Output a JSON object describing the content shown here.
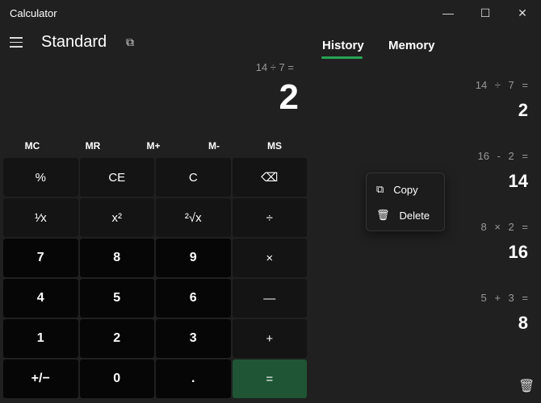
{
  "window": {
    "title": "Calculator",
    "minimize": "—",
    "maximize": "☐",
    "close": "✕"
  },
  "header": {
    "mode": "Standard",
    "keep_on_top": "⧉"
  },
  "display": {
    "expression": "14 ÷ 7 =",
    "result": "2"
  },
  "memory": [
    "MC",
    "MR",
    "M+",
    "M-",
    "MS"
  ],
  "keys": [
    {
      "l": "%",
      "t": "f"
    },
    {
      "l": "CE",
      "t": "f"
    },
    {
      "l": "C",
      "t": "f"
    },
    {
      "l": "⌫",
      "t": "f"
    },
    {
      "l": "¹⁄x",
      "t": "f"
    },
    {
      "l": "x²",
      "t": "f"
    },
    {
      "l": "²√x",
      "t": "f"
    },
    {
      "l": "÷",
      "t": "f"
    },
    {
      "l": "7",
      "t": "d"
    },
    {
      "l": "8",
      "t": "d"
    },
    {
      "l": "9",
      "t": "d"
    },
    {
      "l": "×",
      "t": "f"
    },
    {
      "l": "4",
      "t": "d"
    },
    {
      "l": "5",
      "t": "d"
    },
    {
      "l": "6",
      "t": "d"
    },
    {
      "l": "—",
      "t": "f"
    },
    {
      "l": "1",
      "t": "d"
    },
    {
      "l": "2",
      "t": "d"
    },
    {
      "l": "3",
      "t": "d"
    },
    {
      "l": "+",
      "t": "f"
    },
    {
      "l": "+/−",
      "t": "d"
    },
    {
      "l": "0",
      "t": "d"
    },
    {
      "l": ".",
      "t": "d"
    },
    {
      "l": "=",
      "t": "eq"
    }
  ],
  "tabs": {
    "history": "History",
    "memory": "Memory"
  },
  "history": [
    {
      "e": "14 ÷ 7 =",
      "r": "2"
    },
    {
      "e": "16 - 2 =",
      "r": "14"
    },
    {
      "e": "8 × 2 =",
      "r": "16"
    },
    {
      "e": "5 + 3 =",
      "r": "8"
    }
  ],
  "context_menu": {
    "copy": "Copy",
    "delete": "Delete"
  },
  "colors": {
    "accent": "#26a354",
    "equals": "#1f5535"
  }
}
